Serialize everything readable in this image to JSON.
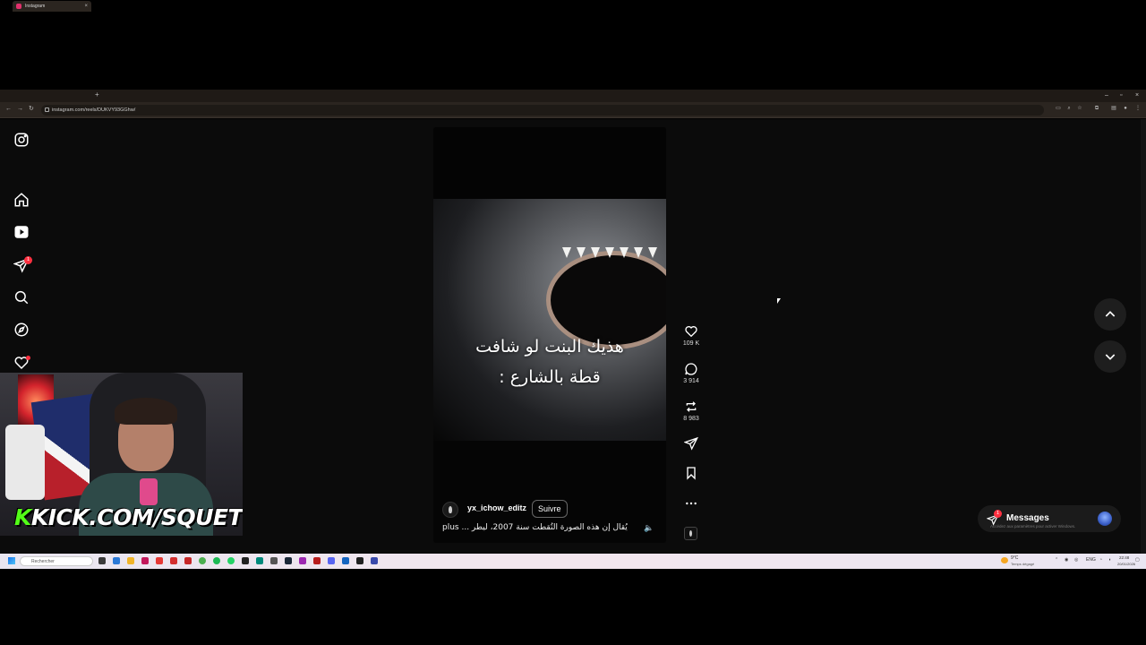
{
  "browser": {
    "tab_title": "Instagram",
    "tab_close": "×",
    "new_tab": "+",
    "url": "instagram.com/reels/DUKVY93GGhw/",
    "window_controls": [
      "–",
      "▫",
      "×"
    ]
  },
  "sidebar": {
    "notification_count": "1"
  },
  "reel": {
    "caption_line1": "هذيك البنت لو شافت",
    "caption_line2": "قطة بالشارع :",
    "username": "yx_ichow_editz",
    "follow_label": "Suivre",
    "description": "يُقال إن هذه الصورة التُقطت سنة 2007، ليطر ... plus",
    "actions": {
      "likes": "109 K",
      "comments": "3 914",
      "reposts": "8 983"
    }
  },
  "messages": {
    "label": "Messages",
    "badge": "1",
    "watermark": "Accédez aux paramètres pour activer Windows."
  },
  "overlay": {
    "kick_text": "KICK.COM/SQUETCHY"
  },
  "taskbar": {
    "search_placeholder": "Rechercher",
    "weather": "9°C",
    "weather_desc": "Temps dégagé",
    "lang": "ENG",
    "time": "22:48",
    "date": "20/01/2026"
  },
  "colors": {
    "badge": "#ff3040",
    "kick_green": "#53fc18",
    "background": "#0b0b0b"
  }
}
